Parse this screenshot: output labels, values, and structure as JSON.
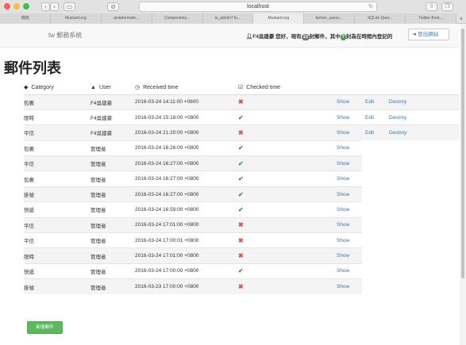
{
  "browser": {
    "url": "localhost",
    "tabs": [
      "總統",
      "Mustard.org",
      "pistaformate...",
      "Components...",
      "is_admin? fu...",
      "Mustard.org",
      "farmer_assoc...",
      "SQLite Quer...",
      "Twitter Boot..."
    ],
    "active_tab": 5
  },
  "navbar": {
    "brand": "tw 郵務系統",
    "greeting_prefix": "F4吳建豪 您好，現有",
    "mail_count": "13",
    "greeting_mid": "封郵件，其中",
    "recent_count": "7",
    "greeting_suffix": "封為在時間內登記的",
    "logout_label": "登出網站"
  },
  "page": {
    "title": "郵件列表",
    "new_button": "新增郵件"
  },
  "table": {
    "headers": {
      "category": "Category",
      "user": "User",
      "received": "Received  time",
      "checked": "Checked  time"
    },
    "link_labels": {
      "show": "Show",
      "edit": "Edit",
      "destroy": "Destroy"
    },
    "rows": [
      {
        "category": "包裹",
        "user": "F4吳建豪",
        "received": "2016-03-24 14:11:00 +0800",
        "checked": false,
        "edit": true
      },
      {
        "category": "限時",
        "user": "F4吳建豪",
        "received": "2016-03-24 15:18:00 +0800",
        "checked": true,
        "edit": true
      },
      {
        "category": "平信",
        "user": "F4吳建豪",
        "received": "2016-03-24 21:20:00 +0800",
        "checked": false,
        "edit": true
      },
      {
        "category": "包裹",
        "user": "管理者",
        "received": "2016-03-24 16:26:00 +0800",
        "checked": true,
        "edit": false
      },
      {
        "category": "平信",
        "user": "管理者",
        "received": "2016-03-24 16:27:00 +0800",
        "checked": true,
        "edit": false
      },
      {
        "category": "包裹",
        "user": "管理者",
        "received": "2016-03-24 16:27:00 +0800",
        "checked": true,
        "edit": false
      },
      {
        "category": "掛號",
        "user": "管理者",
        "received": "2016-03-24 16:27:00 +0800",
        "checked": true,
        "edit": false
      },
      {
        "category": "快遞",
        "user": "管理者",
        "received": "2016-03-24 16:59:00 +0800",
        "checked": true,
        "edit": false
      },
      {
        "category": "平信",
        "user": "管理者",
        "received": "2016-03-24 17:01:00 +0800",
        "checked": false,
        "edit": false
      },
      {
        "category": "平信",
        "user": "管理者",
        "received": "2016-03-24 17:00:01 +0800",
        "checked": false,
        "edit": false
      },
      {
        "category": "限時",
        "user": "管理者",
        "received": "2016-03-24 17:01:00 +0800",
        "checked": false,
        "edit": false
      },
      {
        "category": "快遞",
        "user": "管理者",
        "received": "2016-03-24 17:00:00 +0800",
        "checked": true,
        "edit": false
      },
      {
        "category": "掛號",
        "user": "管理者",
        "received": "2016-03-23 17:00:00 +0800",
        "checked": false,
        "edit": false
      }
    ]
  },
  "colors": {
    "success": "#5cb85c",
    "danger": "#d9534f",
    "link": "#337ab7"
  }
}
